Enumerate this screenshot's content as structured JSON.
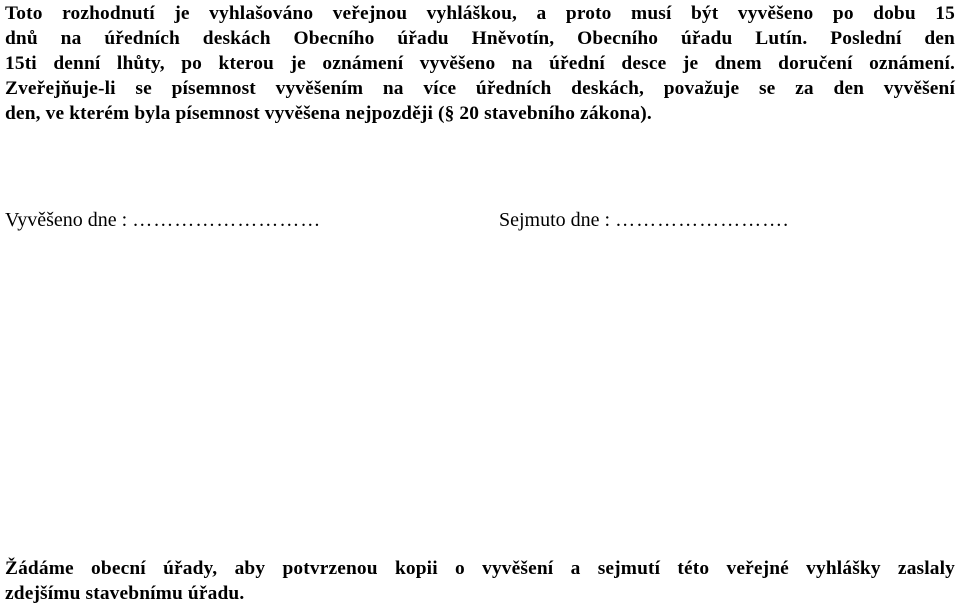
{
  "document": {
    "notice_paragraph": {
      "lines": [
        "Toto  rozhodnutí je vyhlašováno    veřejnou vyhláškou, a proto musí být vyvěšeno  po dobu 15",
        "dnů na úředních deskách   Obecního úřadu   Hněvotín,   Obecního úřadu Lutín. Poslední den",
        "15ti denní lhůty, po kterou je oznámení vyvěšeno na úřední desce  je dnem doručení oznámení.",
        "Zveřejňuje-li se písemnost vyvěšením na více úředních deskách, považuje se za den vyvěšení",
        "den, ve kterém byla písemnost vyvěšena nejpozději (§ 20 stavebního zákona)."
      ]
    },
    "date_fields": {
      "posted": {
        "label": "Vyvěšeno dne :",
        "value": "………………………"
      },
      "removed": {
        "label": "Sejmuto dne :",
        "value": "……………………."
      }
    },
    "request_paragraph": {
      "lines": [
        "Žádáme obecní úřady, aby potvrzenou kopii o vyvěšení a sejmutí této veřejné vyhlášky zaslaly",
        "zdejšímu stavebnímu úřadu."
      ]
    }
  }
}
